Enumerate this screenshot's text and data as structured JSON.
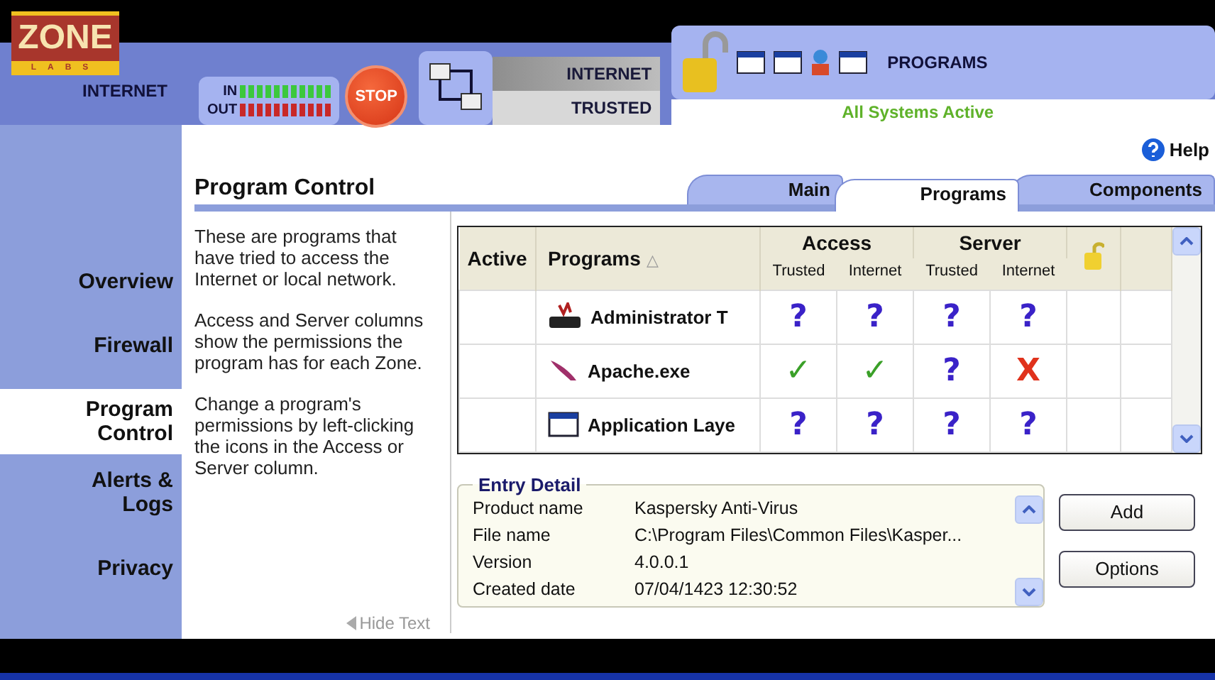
{
  "logo": {
    "word": "ZONE",
    "sub": "LABS"
  },
  "zone_label": "INTERNET",
  "traffic": {
    "in_label": "IN",
    "out_label": "OUT"
  },
  "stop_button": "STOP",
  "zones": [
    "INTERNET",
    "TRUSTED"
  ],
  "programs_label": "PROGRAMS",
  "status": "All Systems Active",
  "help": "Help",
  "sidebar": [
    {
      "label": "Overview",
      "selected": false
    },
    {
      "label": "Firewall",
      "selected": false
    },
    {
      "label": "Program Control",
      "selected": true
    },
    {
      "label": "Alerts & Logs",
      "selected": false
    },
    {
      "label": "Privacy",
      "selected": false
    }
  ],
  "title": "Program Control",
  "tabs": [
    {
      "label": "Main",
      "selected": false
    },
    {
      "label": "Programs",
      "selected": true
    },
    {
      "label": "Components",
      "selected": false
    }
  ],
  "description": [
    "These are programs that have tried to access the Internet or local network.",
    "Access and Server columns show the permissions the program has for each Zone.",
    "Change a program's permissions by left-clicking the icons in the Access or Server column."
  ],
  "hide_text": "Hide Text",
  "table": {
    "columns": {
      "active": "Active",
      "programs": "Programs",
      "sort": "△",
      "access": "Access",
      "server": "Server"
    },
    "subcolumns": [
      "Trusted",
      "Internet",
      "Trusted",
      "Internet"
    ],
    "rows": [
      {
        "name": "Administrator T",
        "kind": "sql",
        "cells": [
          {
            "text": "?",
            "kind": "ask"
          },
          {
            "text": "?",
            "kind": "ask"
          },
          {
            "text": "?",
            "kind": "ask"
          },
          {
            "text": "?",
            "kind": "ask"
          }
        ]
      },
      {
        "name": "Apache.exe",
        "kind": "feather",
        "cells": [
          {
            "text": "✓",
            "kind": "allow"
          },
          {
            "text": "✓",
            "kind": "allow"
          },
          {
            "text": "?",
            "kind": "ask"
          },
          {
            "text": "X",
            "kind": "block"
          }
        ]
      },
      {
        "name": "Application Laye",
        "kind": "window",
        "cells": [
          {
            "text": "?",
            "kind": "ask"
          },
          {
            "text": "?",
            "kind": "ask"
          },
          {
            "text": "?",
            "kind": "ask"
          },
          {
            "text": "?",
            "kind": "ask"
          }
        ]
      }
    ]
  },
  "entry_detail": {
    "title": "Entry Detail",
    "fields": [
      {
        "label": "Product name",
        "value": "Kaspersky Anti-Virus"
      },
      {
        "label": "File name",
        "value": "C:\\Program Files\\Common Files\\Kasper..."
      },
      {
        "label": "Version",
        "value": "4.0.0.1"
      },
      {
        "label": "Created date",
        "value": "07/04/1423 12:30:52"
      }
    ]
  },
  "buttons": [
    "Add",
    "Options"
  ]
}
